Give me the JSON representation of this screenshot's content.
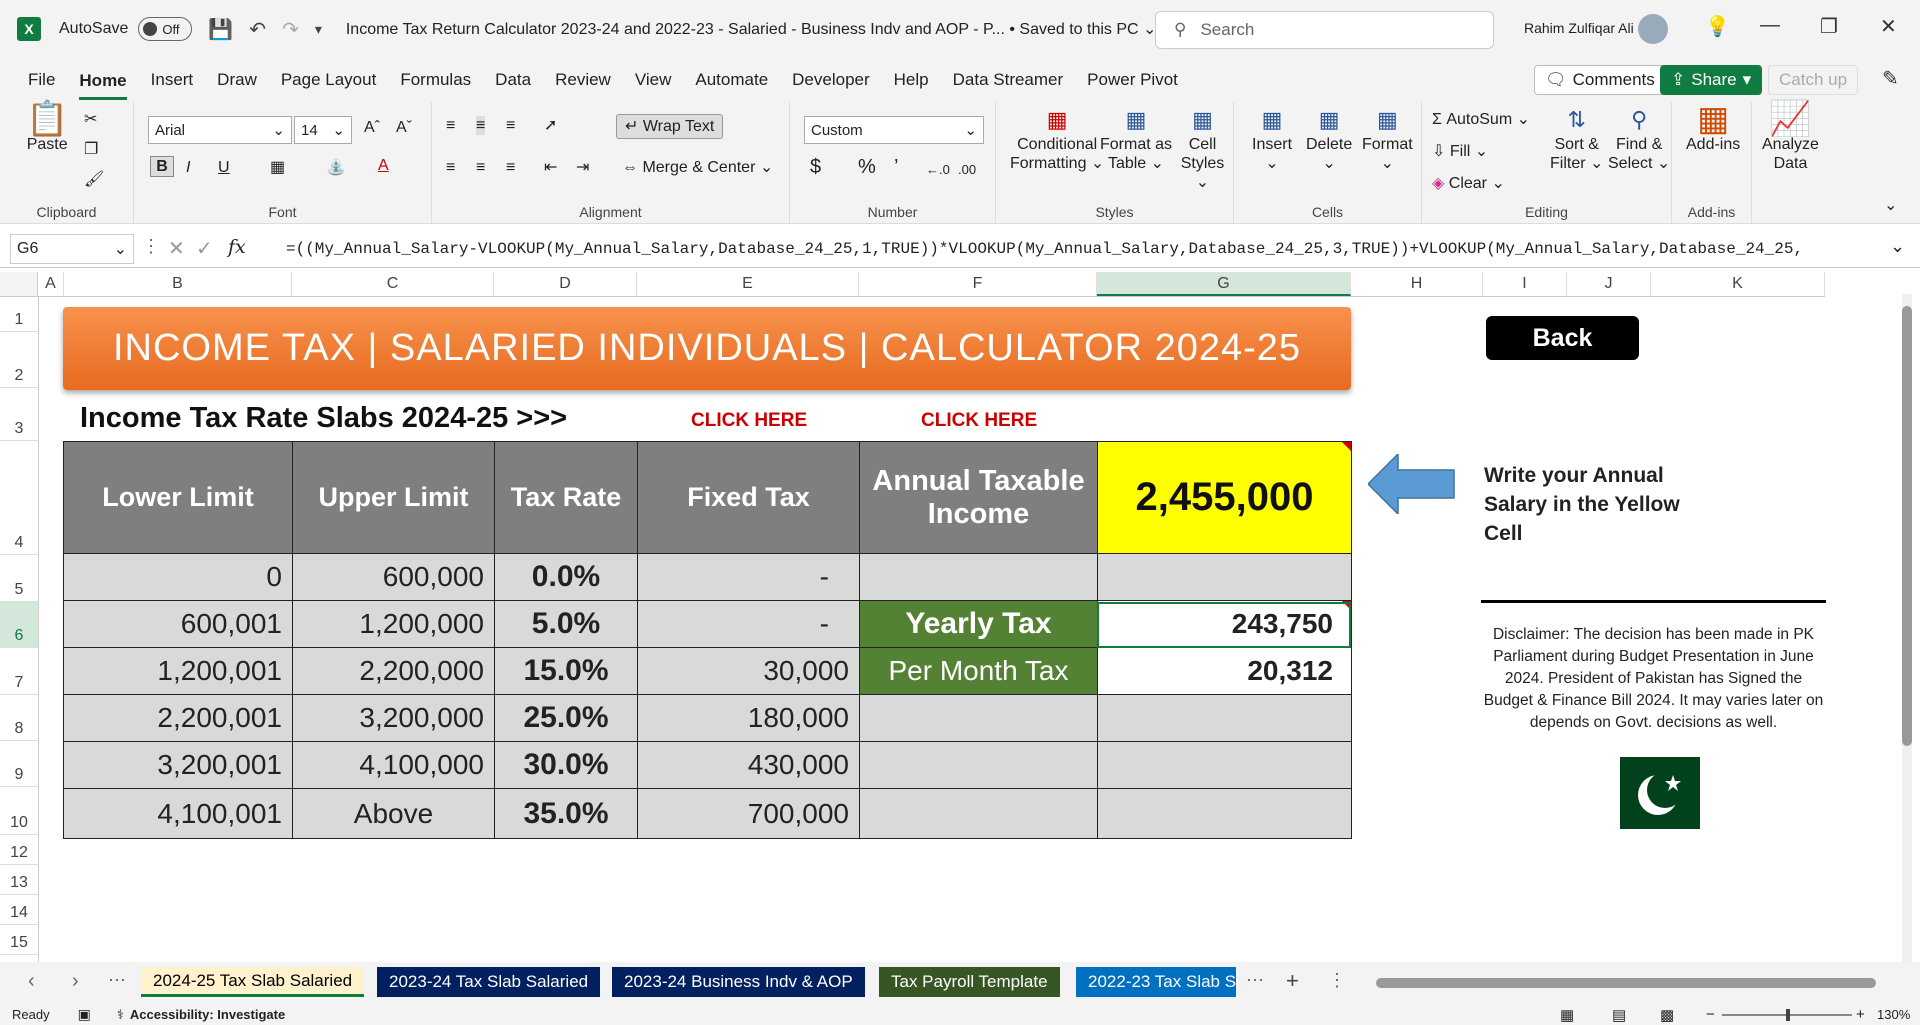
{
  "titlebar": {
    "autosave": "AutoSave",
    "toggle": "Off",
    "title": "Income Tax Return Calculator 2023-24 and 2022-23 - Salaried - Business Indv and AOP - P...",
    "saved": "• Saved to this PC",
    "search": "Search",
    "user": "Rahim Zulfiqar Ali"
  },
  "menu": {
    "items": [
      "File",
      "Home",
      "Insert",
      "Draw",
      "Page Layout",
      "Formulas",
      "Data",
      "Review",
      "View",
      "Automate",
      "Developer",
      "Help",
      "Data Streamer",
      "Power Pivot"
    ],
    "comments": "Comments",
    "share": "Share",
    "catchup": "Catch up"
  },
  "ribbon": {
    "paste": "Paste",
    "clipboard": "Clipboard",
    "font_name": "Arial",
    "font_size": "14",
    "font": "Font",
    "wrap": "Wrap Text",
    "merge": "Merge & Center",
    "alignment": "Alignment",
    "number_format": "Custom",
    "number": "Number",
    "cond1": "Conditional",
    "cond2": "Formatting",
    "fat1": "Format as",
    "fat2": "Table",
    "cs1": "Cell",
    "cs2": "Styles",
    "styles": "Styles",
    "insert": "Insert",
    "delete": "Delete",
    "format": "Format",
    "cells": "Cells",
    "autosum": "AutoSum",
    "fill": "Fill",
    "clear": "Clear",
    "sf1": "Sort &",
    "sf2": "Filter",
    "fs1": "Find &",
    "fs2": "Select",
    "editing": "Editing",
    "addins": "Add-ins",
    "addins_grp": "Add-ins",
    "ad1": "Analyze",
    "ad2": "Data"
  },
  "formula_bar": {
    "namebox": "G6",
    "fx": "fx",
    "formula": "=((My_Annual_Salary-VLOOKUP(My_Annual_Salary,Database_24_25,1,TRUE))*VLOOKUP(My_Annual_Salary,Database_24_25,3,TRUE))+VLOOKUP(My_Annual_Salary,Database_24_25,"
  },
  "columns": [
    "A",
    "B",
    "C",
    "D",
    "E",
    "F",
    "G",
    "H",
    "I",
    "J",
    "K"
  ],
  "rows": [
    "1",
    "2",
    "3",
    "4",
    "5",
    "6",
    "7",
    "8",
    "9",
    "10",
    "12",
    "13",
    "14",
    "15"
  ],
  "sheet": {
    "banner": "INCOME TAX | SALARIED INDIVIDUALS | CALCULATOR 2024-25",
    "slab_title": "Income Tax Rate Slabs 2024-25 >>>",
    "click1": "CLICK HERE",
    "click2": "CLICK HERE",
    "headers": [
      "Lower Limit",
      "Upper Limit",
      "Tax Rate",
      "Fixed Tax"
    ],
    "ati_label": "Annual Taxable Income",
    "ati_value": "2,455,000",
    "slabs": [
      {
        "lower": "0",
        "upper": "600,000",
        "rate": "0.0%",
        "fixed": "-"
      },
      {
        "lower": "600,001",
        "upper": "1,200,000",
        "rate": "5.0%",
        "fixed": "-"
      },
      {
        "lower": "1,200,001",
        "upper": "2,200,000",
        "rate": "15.0%",
        "fixed": "30,000"
      },
      {
        "lower": "2,200,001",
        "upper": "3,200,000",
        "rate": "25.0%",
        "fixed": "180,000"
      },
      {
        "lower": "3,200,001",
        "upper": "4,100,000",
        "rate": "30.0%",
        "fixed": "430,000"
      },
      {
        "lower": "4,100,001",
        "upper": "Above",
        "rate": "35.0%",
        "fixed": "700,000"
      }
    ],
    "yearly_label": "Yearly Tax",
    "yearly_value": "243,750",
    "monthly_label": "Per Month Tax",
    "monthly_value": "20,312",
    "back": "Back",
    "instruction": "Write your Annual Salary in the Yellow Cell",
    "disclaimer": "Disclaimer: The decision has been made in PK Parliament during Budget Presentation in June 2024. President of Pakistan has Signed the Budget & Finance Bill 2024. It may varies later on depends on Govt. decisions as well."
  },
  "tabs": [
    {
      "label": "2024-25 Tax Slab Salaried",
      "bg": "#fff2cc",
      "fg": "#000"
    },
    {
      "label": "2023-24 Tax Slab Salaried",
      "bg": "#002060",
      "fg": "#fff"
    },
    {
      "label": "2023-24 Business Indv & AOP",
      "bg": "#002060",
      "fg": "#fff"
    },
    {
      "label": "Tax Payroll Template",
      "bg": "#375623",
      "fg": "#fff"
    },
    {
      "label": "2022-23 Tax Slab S",
      "bg": "#0070c0",
      "fg": "#fff"
    }
  ],
  "status": {
    "ready": "Ready",
    "accessibility": "Accessibility: Investigate",
    "zoom": "130%"
  }
}
